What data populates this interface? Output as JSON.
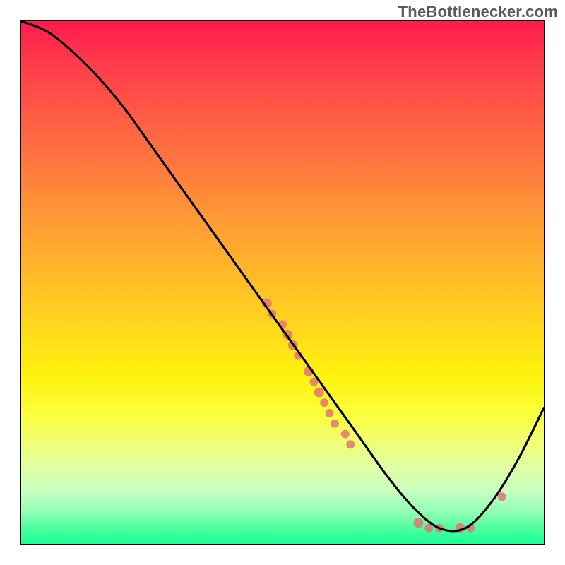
{
  "watermark": "TheBottlenecker.com",
  "chart_data": {
    "type": "line",
    "title": "",
    "xlabel": "",
    "ylabel": "",
    "xlim": [
      0,
      100
    ],
    "ylim": [
      0,
      100
    ],
    "series": [
      {
        "name": "curve",
        "x": [
          0,
          5,
          10,
          15,
          20,
          25,
          30,
          35,
          40,
          45,
          50,
          55,
          60,
          65,
          70,
          75,
          80,
          85,
          90,
          95,
          100
        ],
        "y": [
          100,
          98,
          94,
          89,
          83,
          76,
          69,
          62,
          55,
          48,
          41,
          34,
          27,
          20,
          13,
          7,
          3,
          3,
          8,
          16,
          26
        ]
      }
    ],
    "scatter": [
      {
        "x": 47,
        "y": 46,
        "r": 7
      },
      {
        "x": 48,
        "y": 44,
        "r": 6
      },
      {
        "x": 50,
        "y": 42,
        "r": 6
      },
      {
        "x": 51,
        "y": 40,
        "r": 7
      },
      {
        "x": 52,
        "y": 38,
        "r": 7
      },
      {
        "x": 53,
        "y": 36,
        "r": 6
      },
      {
        "x": 55,
        "y": 33,
        "r": 7
      },
      {
        "x": 56,
        "y": 31,
        "r": 6
      },
      {
        "x": 57,
        "y": 29,
        "r": 7
      },
      {
        "x": 58,
        "y": 27,
        "r": 6
      },
      {
        "x": 59,
        "y": 25,
        "r": 6
      },
      {
        "x": 60,
        "y": 23,
        "r": 6
      },
      {
        "x": 62,
        "y": 21,
        "r": 6
      },
      {
        "x": 63,
        "y": 19,
        "r": 6
      },
      {
        "x": 76,
        "y": 4,
        "r": 7
      },
      {
        "x": 78,
        "y": 3,
        "r": 6
      },
      {
        "x": 80,
        "y": 3,
        "r": 6
      },
      {
        "x": 84,
        "y": 3,
        "r": 7
      },
      {
        "x": 86,
        "y": 3,
        "r": 6
      },
      {
        "x": 92,
        "y": 9,
        "r": 6
      }
    ],
    "colors": {
      "line": "#000000",
      "scatter": "#e57373"
    }
  }
}
